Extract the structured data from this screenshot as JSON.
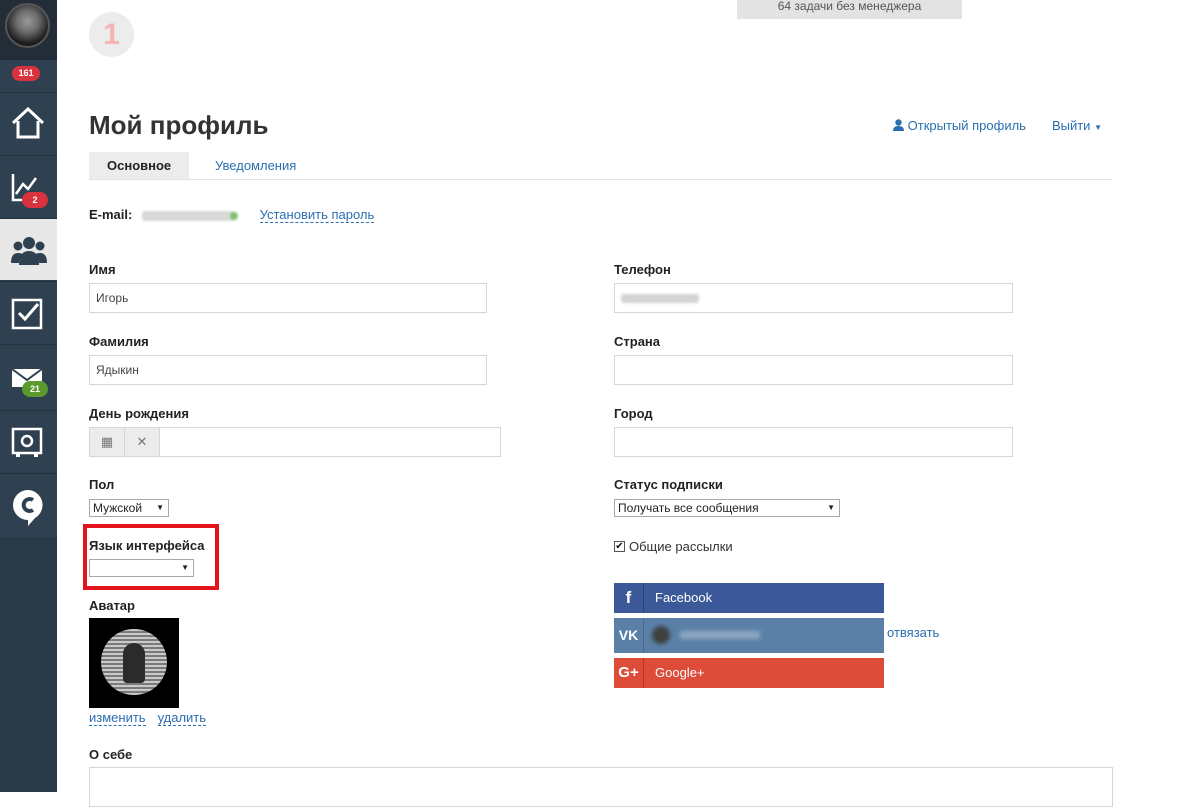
{
  "sidebar": {
    "top_badge": "161",
    "items": [
      {
        "icon": "home-icon",
        "badge": ""
      },
      {
        "icon": "chart-icon",
        "badge": "2",
        "badge_color": "#d9333f"
      },
      {
        "icon": "users-icon",
        "badge": "",
        "active": true
      },
      {
        "icon": "checkbox-icon",
        "badge": ""
      },
      {
        "icon": "mail-icon",
        "badge": "21",
        "badge_color": "#5a9a2e"
      },
      {
        "icon": "settings-icon",
        "badge": ""
      },
      {
        "icon": "chat-icon",
        "badge": ""
      }
    ]
  },
  "header": {
    "task_number": "1",
    "banner": "64 задачи без менеджера",
    "title": "Мой профиль",
    "open_profile": "Открытый профиль",
    "logout": "Выйти"
  },
  "tabs": [
    "Основное",
    "Уведомления"
  ],
  "email": {
    "label": "E-mail",
    "set_password": "Установить пароль"
  },
  "form": {
    "first_name_label": "Имя",
    "first_name_value": "Игорь",
    "last_name_label": "Фамилия",
    "last_name_value": "Ядыкин",
    "birthday_label": "День рождения",
    "gender_label": "Пол",
    "gender_value": "Мужской",
    "language_label": "Язык интерфейса",
    "language_value": "",
    "avatar_label": "Аватар",
    "avatar_change": "изменить",
    "avatar_delete": "удалить",
    "about_label": "О себе",
    "phone_label": "Телефон",
    "country_label": "Страна",
    "country_value": "",
    "city_label": "Город",
    "city_value": "",
    "subscription_label": "Статус подписки",
    "subscription_value": "Получать все сообщения",
    "newsletter_label": "Общие рассылки",
    "newsletter_checked": true
  },
  "social": {
    "facebook": "Facebook",
    "google": "Google+",
    "unlink": "отвязать"
  },
  "colors": {
    "sidebar_bg": "#2f4050",
    "link": "#2a6fb0",
    "highlight_box": "#e0141a",
    "facebook": "#3b5998",
    "vk": "#5a80a7",
    "google": "#dd4b39"
  }
}
